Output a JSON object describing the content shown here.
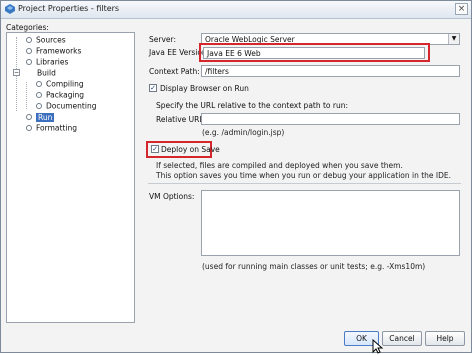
{
  "window": {
    "title": "Project Properties - filters"
  },
  "categories": {
    "label": "Categories:",
    "items": [
      {
        "label": "Sources"
      },
      {
        "label": "Frameworks"
      },
      {
        "label": "Libraries"
      },
      {
        "label": "Build"
      },
      {
        "label": "Compiling"
      },
      {
        "label": "Packaging"
      },
      {
        "label": "Documenting"
      },
      {
        "label": "Run"
      },
      {
        "label": "Formatting"
      }
    ]
  },
  "form": {
    "server_label": "Server:",
    "server_value": "Oracle WebLogic Server",
    "javaee_label": "Java EE Version:",
    "javaee_value": "Java EE 6 Web",
    "context_label": "Context Path:",
    "context_value": "/filters",
    "display_browser_label": "Display Browser on Run",
    "display_browser_checked": true,
    "specify_text": "Specify the URL relative to the context path to run:",
    "relative_url_label": "Relative URL:",
    "relative_url_value": "",
    "relative_url_example": "(e.g. /admin/login.jsp)",
    "deploy_label": "Deploy on Save",
    "deploy_checked": true,
    "deploy_info_1": "If selected, files are compiled and deployed when you save them.",
    "deploy_info_2": "This option saves you time when you run or debug your application in the IDE.",
    "vm_label": "VM Options:",
    "vm_value": "",
    "vm_hint": "(used for running main classes or unit tests; e.g. -Xms10m)"
  },
  "buttons": {
    "ok": "OK",
    "cancel": "Cancel",
    "help": "Help"
  },
  "colors": {
    "highlight": "#d6262d",
    "selection": "#3d6fbf"
  }
}
